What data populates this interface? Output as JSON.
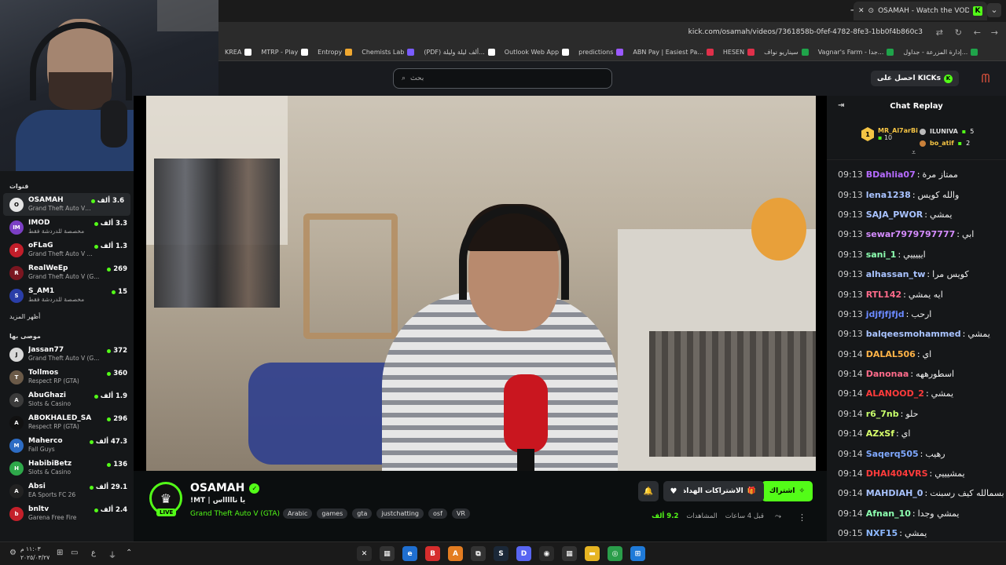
{
  "browser": {
    "tab_title": "OSAMAH - Watch the VOD",
    "new_tab": "+",
    "tab_close": "✕",
    "url": "kick.com/osamah/videos/7361858b-0fef-4782-8fe3-1bb0f4b860c3",
    "bookmarks": [
      {
        "label": "KREA",
        "color": "#ffffff"
      },
      {
        "label": "MTRP - Play",
        "color": "#ffffff"
      },
      {
        "label": "Entropy",
        "color": "#f0a830"
      },
      {
        "label": "Chemists Lab",
        "color": "#7a5cff"
      },
      {
        "label": "(PDF) ألف ليلة وليلة...",
        "color": "#ffffff"
      },
      {
        "label": "Outlook Web App",
        "color": "#ffffff"
      },
      {
        "label": "predictions",
        "color": "#9b59ff"
      },
      {
        "label": "ABN Pay | Easiest Pa...",
        "color": "#e0304a"
      },
      {
        "label": "HESEN",
        "color": "#e0304a"
      },
      {
        "label": "سيناريو نواف",
        "color": "#1fa44a"
      },
      {
        "label": "Vagnar's Farm - جدا...",
        "color": "#1fa44a"
      },
      {
        "label": "إدارة المزرعة - جداول...",
        "color": "#1fa44a"
      }
    ]
  },
  "kick": {
    "search_placeholder": "بحث",
    "get_kicks": "احصل على KICKs"
  },
  "sidebar": {
    "channels_title": "قنوات",
    "channels": [
      {
        "name": "OSAMAH",
        "sub": "Grand Theft Auto V ...",
        "viewers": "3.6 ألف",
        "avatar_color": "#e5e5e5",
        "avatar_text": "O"
      },
      {
        "name": "IMOD",
        "sub": "مخصصة للدردشة فقط",
        "viewers": "3.3 ألف",
        "avatar_color": "#7b3fc4",
        "avatar_text": "IM"
      },
      {
        "name": "oFLaG",
        "sub": "Grand Theft Auto V ...",
        "viewers": "1.3 ألف",
        "avatar_color": "#c21e2a",
        "avatar_text": "F"
      },
      {
        "name": "RealWeEp",
        "sub": "Grand Theft Auto V (G...",
        "viewers": "269",
        "avatar_color": "#7a1620",
        "avatar_text": "R"
      },
      {
        "name": "S_AM1",
        "sub": "مخصصة للدردشة فقط",
        "viewers": "15",
        "avatar_color": "#2a3ea8",
        "avatar_text": "S"
      }
    ],
    "show_more": "أظهر المزيد",
    "recommended_title": "موصى بها",
    "recommended": [
      {
        "name": "Jassan77",
        "sub": "Grand Theft Auto V (G...",
        "viewers": "372",
        "avatar_color": "#d8d8d8",
        "avatar_text": "J"
      },
      {
        "name": "Tollmos",
        "sub": "Respect RP (GTA)",
        "viewers": "360",
        "avatar_color": "#6b5a48",
        "avatar_text": "T"
      },
      {
        "name": "AbuGhazi",
        "sub": "Slots & Casino",
        "viewers": "1.9 ألف",
        "avatar_color": "#3b3b3b",
        "avatar_text": "A"
      },
      {
        "name": "ABOKHALED_SA",
        "sub": "Respect RP (GTA)",
        "viewers": "296",
        "avatar_color": "#111111",
        "avatar_text": "A"
      },
      {
        "name": "Maherco",
        "sub": "Fall Guys",
        "viewers": "47.3 ألف",
        "avatar_color": "#2d6cc4",
        "avatar_text": "M"
      },
      {
        "name": "HabibiBetz",
        "sub": "Slots & Casino",
        "viewers": "136",
        "avatar_color": "#2ea84a",
        "avatar_text": "H"
      },
      {
        "name": "Absi",
        "sub": "EA Sports FC 26",
        "viewers": "29.1 ألف",
        "avatar_color": "#222222",
        "avatar_text": "A"
      },
      {
        "name": "bnltv",
        "sub": "Garena Free Fire",
        "viewers": "2.4 ألف",
        "avatar_color": "#c4202a",
        "avatar_text": "b"
      }
    ]
  },
  "stream": {
    "channel": "OSAMAH",
    "live": "LIVE",
    "title": "!MT | يا ناااااس",
    "category": "Grand Theft Auto V (GTA)",
    "tags": [
      "Arabic",
      "games",
      "gta",
      "justchatting",
      "osf",
      "VR"
    ],
    "subscribe": "اشتراك",
    "gift_subs": "الاشتراكات الهداة",
    "time_ago": "قبل 4 ساعات",
    "views_label": "المشاهدات",
    "views": "9.2 ألف"
  },
  "chat": {
    "title": "Chat Replay",
    "top_gifters": [
      {
        "name": "MR_Al7arBi",
        "count": "10",
        "rank": "1"
      },
      {
        "name": "ILUNIVA",
        "count": "5"
      },
      {
        "name": "bo_atif",
        "count": "2"
      }
    ],
    "messages": [
      {
        "time": "09:13",
        "user": "BDahlia07",
        "text": "ممتاز مرة",
        "color": "#b66bff"
      },
      {
        "time": "09:13",
        "user": "lena1238",
        "text": "والله كويس",
        "color": "#a9c3ff"
      },
      {
        "time": "09:13",
        "user": "SAJA_PWOR",
        "text": "يمشي",
        "color": "#a9c3ff"
      },
      {
        "time": "09:13",
        "user": "sewar7979797777",
        "text": "ابي",
        "color": "#d58cff"
      },
      {
        "time": "09:13",
        "user": "sani_1",
        "text": "ايييييي",
        "color": "#8dffb0"
      },
      {
        "time": "09:13",
        "user": "alhassan_tw",
        "text": "كويس مرا",
        "color": "#a9c3ff"
      },
      {
        "time": "09:13",
        "user": "RTL142",
        "text": "ايه يمشي",
        "color": "#ff6b8a"
      },
      {
        "time": "09:13",
        "user": "jdjfjfjfjd",
        "text": "ارحب",
        "color": "#6b8aff"
      },
      {
        "time": "09:13",
        "user": "balqeesmohammed",
        "text": "يمشي",
        "color": "#a9c3ff"
      },
      {
        "time": "09:14",
        "user": "DALAL506",
        "text": "اي",
        "color": "#ffb347"
      },
      {
        "time": "09:14",
        "user": "Danonaa",
        "text": "اسطورههه",
        "color": "#ff6b8a"
      },
      {
        "time": "09:14",
        "user": "ALANOOD_2",
        "text": "يمشي",
        "color": "#ff3b3b"
      },
      {
        "time": "09:14",
        "user": "r6_7nb",
        "text": "حلو",
        "color": "#c8ff6b"
      },
      {
        "time": "09:14",
        "user": "AZxSf",
        "text": "اي",
        "color": "#d8ff6b"
      },
      {
        "time": "09:14",
        "user": "Saqerq505",
        "text": "رهيب",
        "color": "#7fa8ff"
      },
      {
        "time": "09:14",
        "user": "DHAI404VRS",
        "text": "يمشيييي",
        "color": "#ff3b3b"
      },
      {
        "time": "09:14",
        "user": "MAHDIAH_0",
        "text": "بسمالله كيف رسبنت",
        "color": "#a9c3ff"
      },
      {
        "time": "09:14",
        "user": "Afnan_10",
        "text": "يمشي وجدا",
        "color": "#8dffb0"
      },
      {
        "time": "09:15",
        "user": "NXF15",
        "text": "يمشي",
        "color": "#8db8ff"
      }
    ]
  },
  "taskbar": {
    "time": "١١:٠٣ م",
    "date": "٢٠٢٥/٠٣/٢٧"
  }
}
